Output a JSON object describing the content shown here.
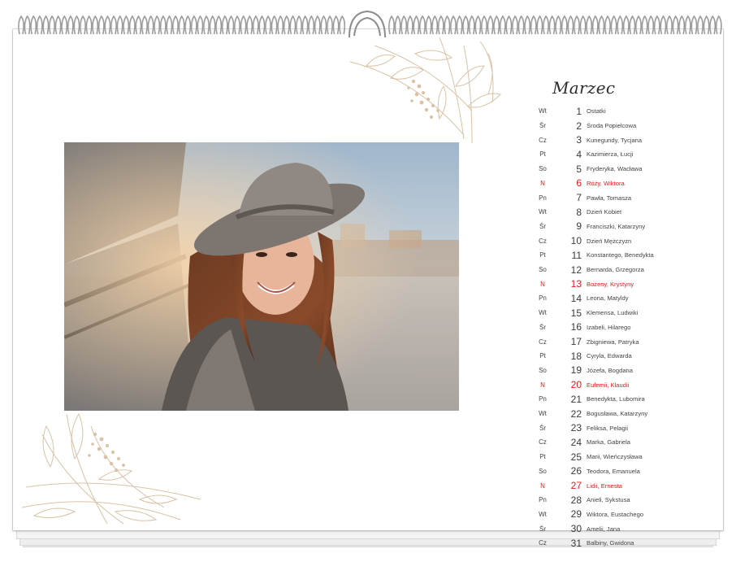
{
  "calendar": {
    "month": "Marzec",
    "sunday_color": "#e21b1b",
    "text_color": "#3a3a3a",
    "botanical_color": "#d9c2a6",
    "days": [
      {
        "dow": "Wt",
        "day": "1",
        "names": "Ostatki",
        "holiday": false
      },
      {
        "dow": "Śr",
        "day": "2",
        "names": "Środa Popielcowa",
        "holiday": false
      },
      {
        "dow": "Cz",
        "day": "3",
        "names": "Kunegundy, Tycjana",
        "holiday": false
      },
      {
        "dow": "Pt",
        "day": "4",
        "names": "Kazimierza, Łucji",
        "holiday": false
      },
      {
        "dow": "So",
        "day": "5",
        "names": "Fryderyka, Wacława",
        "holiday": false
      },
      {
        "dow": "N",
        "day": "6",
        "names": "Róży, Wiktora",
        "holiday": true
      },
      {
        "dow": "Pn",
        "day": "7",
        "names": "Pawła, Tomasza",
        "holiday": false
      },
      {
        "dow": "Wt",
        "day": "8",
        "names": "Dzień Kobiet",
        "holiday": false
      },
      {
        "dow": "Śr",
        "day": "9",
        "names": "Franciszki, Katarzyny",
        "holiday": false
      },
      {
        "dow": "Cz",
        "day": "10",
        "names": "Dzień Mężczyzn",
        "holiday": false
      },
      {
        "dow": "Pt",
        "day": "11",
        "names": "Konstantego, Benedykta",
        "holiday": false
      },
      {
        "dow": "So",
        "day": "12",
        "names": "Bernarda, Grzegorza",
        "holiday": false
      },
      {
        "dow": "N",
        "day": "13",
        "names": "Bożeny, Krystyny",
        "holiday": true
      },
      {
        "dow": "Pn",
        "day": "14",
        "names": "Leona, Matyldy",
        "holiday": false
      },
      {
        "dow": "Wt",
        "day": "15",
        "names": "Klemensa, Ludwiki",
        "holiday": false
      },
      {
        "dow": "Śr",
        "day": "16",
        "names": "Izabeli, Hilarego",
        "holiday": false
      },
      {
        "dow": "Cz",
        "day": "17",
        "names": "Zbigniewa, Patryka",
        "holiday": false
      },
      {
        "dow": "Pt",
        "day": "18",
        "names": "Cyryla, Edwarda",
        "holiday": false
      },
      {
        "dow": "So",
        "day": "19",
        "names": "Józefa, Bogdana",
        "holiday": false
      },
      {
        "dow": "N",
        "day": "20",
        "names": "Eufemii, Klaudii",
        "holiday": true
      },
      {
        "dow": "Pn",
        "day": "21",
        "names": "Benedykta, Lubomira",
        "holiday": false
      },
      {
        "dow": "Wt",
        "day": "22",
        "names": "Bogusława, Katarzyny",
        "holiday": false
      },
      {
        "dow": "Śr",
        "day": "23",
        "names": "Feliksa, Pelagii",
        "holiday": false
      },
      {
        "dow": "Cz",
        "day": "24",
        "names": "Marka, Gabriela",
        "holiday": false
      },
      {
        "dow": "Pt",
        "day": "25",
        "names": "Marii, Wieńczysława",
        "holiday": false
      },
      {
        "dow": "So",
        "day": "26",
        "names": "Teodora, Emanuela",
        "holiday": false
      },
      {
        "dow": "N",
        "day": "27",
        "names": "Lidii, Ernesta",
        "holiday": true
      },
      {
        "dow": "Pn",
        "day": "28",
        "names": "Anieli, Sykstusa",
        "holiday": false
      },
      {
        "dow": "Wt",
        "day": "29",
        "names": "Wiktora, Eustachego",
        "holiday": false
      },
      {
        "dow": "Śr",
        "day": "30",
        "names": "Amelii, Jana",
        "holiday": false
      },
      {
        "dow": "Cz",
        "day": "31",
        "names": "Balbiny, Gwidona",
        "holiday": false
      }
    ]
  },
  "photo": {
    "subject": "smiling woman in felt hat on bridge",
    "icon": "portrait-photo"
  }
}
